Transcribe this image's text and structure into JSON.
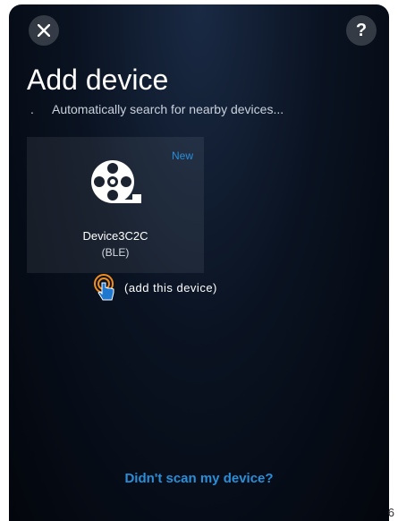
{
  "header": {
    "close_icon": "close-icon",
    "help_label": "?"
  },
  "title": "Add device",
  "subtitle": "Automatically search for nearby devices...",
  "device_card": {
    "badge": "New",
    "icon": "device-reel-icon",
    "name": "Device3C2C",
    "type": "(BLE)"
  },
  "tap_hint": {
    "icon": "tap-hand-icon",
    "text": "(add this device)"
  },
  "bottom_link": "Didn't scan my device?",
  "page_number": "6",
  "colors": {
    "accent": "#2a8ed8",
    "tap_accent": "#f28c1c"
  }
}
